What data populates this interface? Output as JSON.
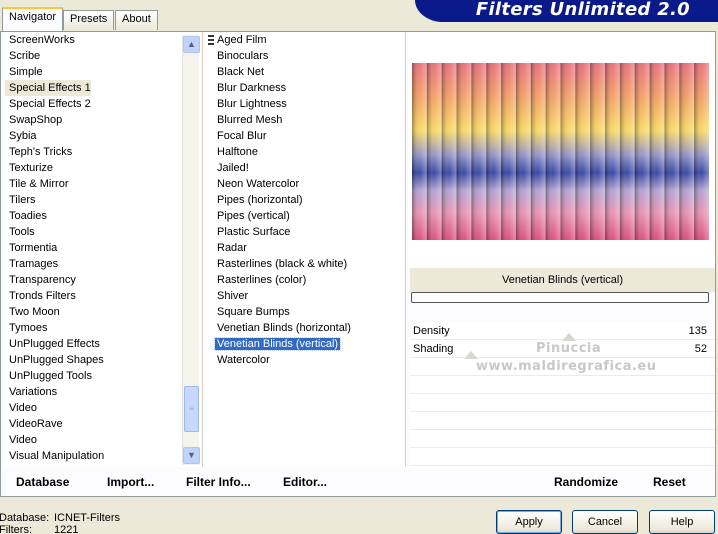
{
  "tabs": [
    "Navigator",
    "Presets",
    "About"
  ],
  "banner": {
    "title": "Filters Unlimited 2.0"
  },
  "categories": [
    "ScreenWorks",
    "Scribe",
    "Simple",
    "Special Effects 1",
    "Special Effects 2",
    "SwapShop",
    "Sybia",
    "Teph's Tricks",
    "Texturize",
    "Tile & Mirror",
    "Tilers",
    "Toadies",
    "Tools",
    "Tormentia",
    "Tramages",
    "Transparency",
    "Tronds Filters",
    "Two Moon",
    "Tymoes",
    "UnPlugged Effects",
    "UnPlugged Shapes",
    "UnPlugged Tools",
    "Variations",
    "Video",
    "VideoRave",
    "Video",
    "Visual Manipulation"
  ],
  "selected_category": "Special Effects 1",
  "filters": [
    "Aged Film",
    "Binoculars",
    "Black Net",
    "Blur Darkness",
    "Blur Lightness",
    "Blurred Mesh",
    "Focal Blur",
    "Halftone",
    "Jailed!",
    "Neon Watercolor",
    "Pipes (horizontal)",
    "Pipes (vertical)",
    "Plastic Surface",
    "Radar",
    "Rasterlines (black & white)",
    "Rasterlines (color)",
    "Shiver",
    "Square Bumps",
    "Venetian Blinds (horizontal)",
    "Venetian Blinds (vertical)",
    "Watercolor"
  ],
  "selected_filter": "Venetian Blinds (vertical)",
  "filter_name": "Venetian Blinds (vertical)",
  "params": [
    {
      "label": "Density",
      "value": "135"
    },
    {
      "label": "Shading",
      "value": "52"
    }
  ],
  "watermark": {
    "line1": "Pinuccia",
    "line2": "www.maldiregrafica.eu"
  },
  "buttons": {
    "database": "Database",
    "import": "Import...",
    "filter_info": "Filter Info...",
    "editor": "Editor...",
    "randomize": "Randomize",
    "reset": "Reset",
    "apply": "Apply",
    "cancel": "Cancel",
    "help": "Help"
  },
  "status": {
    "database_label": "Database:",
    "database_value": "ICNET-Filters",
    "filters_label": "Filters:",
    "filters_value": "1221"
  },
  "icons": {
    "scroll_up": "arrow-up-icon",
    "scroll_down": "arrow-down-icon",
    "grip": "grip-icon"
  },
  "colors": {
    "banner": "#0a1a8a",
    "selection": "#316ac5",
    "tab_highlight": "#ffc83c"
  }
}
